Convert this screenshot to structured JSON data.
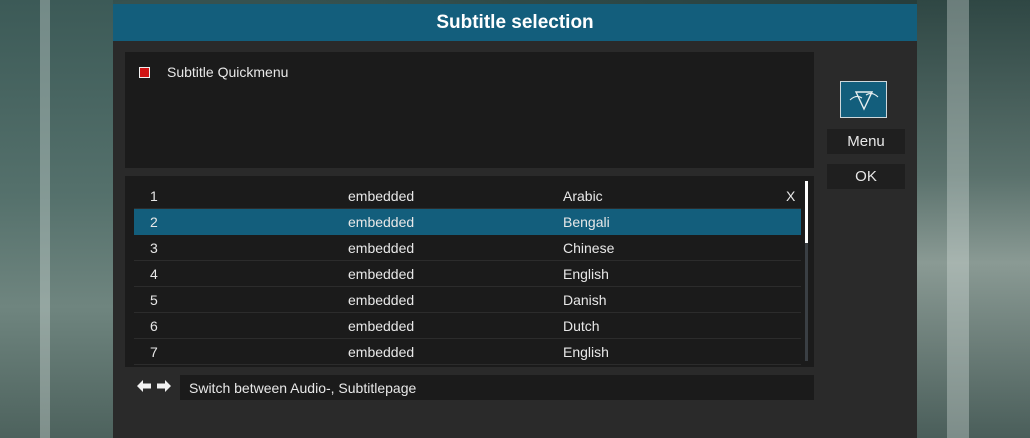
{
  "dialog": {
    "title": "Subtitle selection"
  },
  "quickmenu": {
    "label": "Subtitle Quickmenu"
  },
  "tracks": [
    {
      "num": "1",
      "type": "embedded",
      "language": "Arabic",
      "mark": "X"
    },
    {
      "num": "2",
      "type": "embedded",
      "language": "Bengali",
      "mark": ""
    },
    {
      "num": "3",
      "type": "embedded",
      "language": "Chinese",
      "mark": ""
    },
    {
      "num": "4",
      "type": "embedded",
      "language": "English",
      "mark": ""
    },
    {
      "num": "5",
      "type": "embedded",
      "language": "Danish",
      "mark": ""
    },
    {
      "num": "6",
      "type": "embedded",
      "language": "Dutch",
      "mark": ""
    },
    {
      "num": "7",
      "type": "embedded",
      "language": "English",
      "mark": ""
    }
  ],
  "selected_track": "2",
  "buttons": {
    "menu": "Menu",
    "ok": "OK"
  },
  "hint": {
    "text": "Switch between Audio-, Subtitlepage"
  },
  "icons": {
    "logo": "purex-logo-icon",
    "left": "arrow-left-icon",
    "right": "arrow-right-icon"
  },
  "colors": {
    "accent": "#135e7c",
    "marker": "#d01414"
  }
}
